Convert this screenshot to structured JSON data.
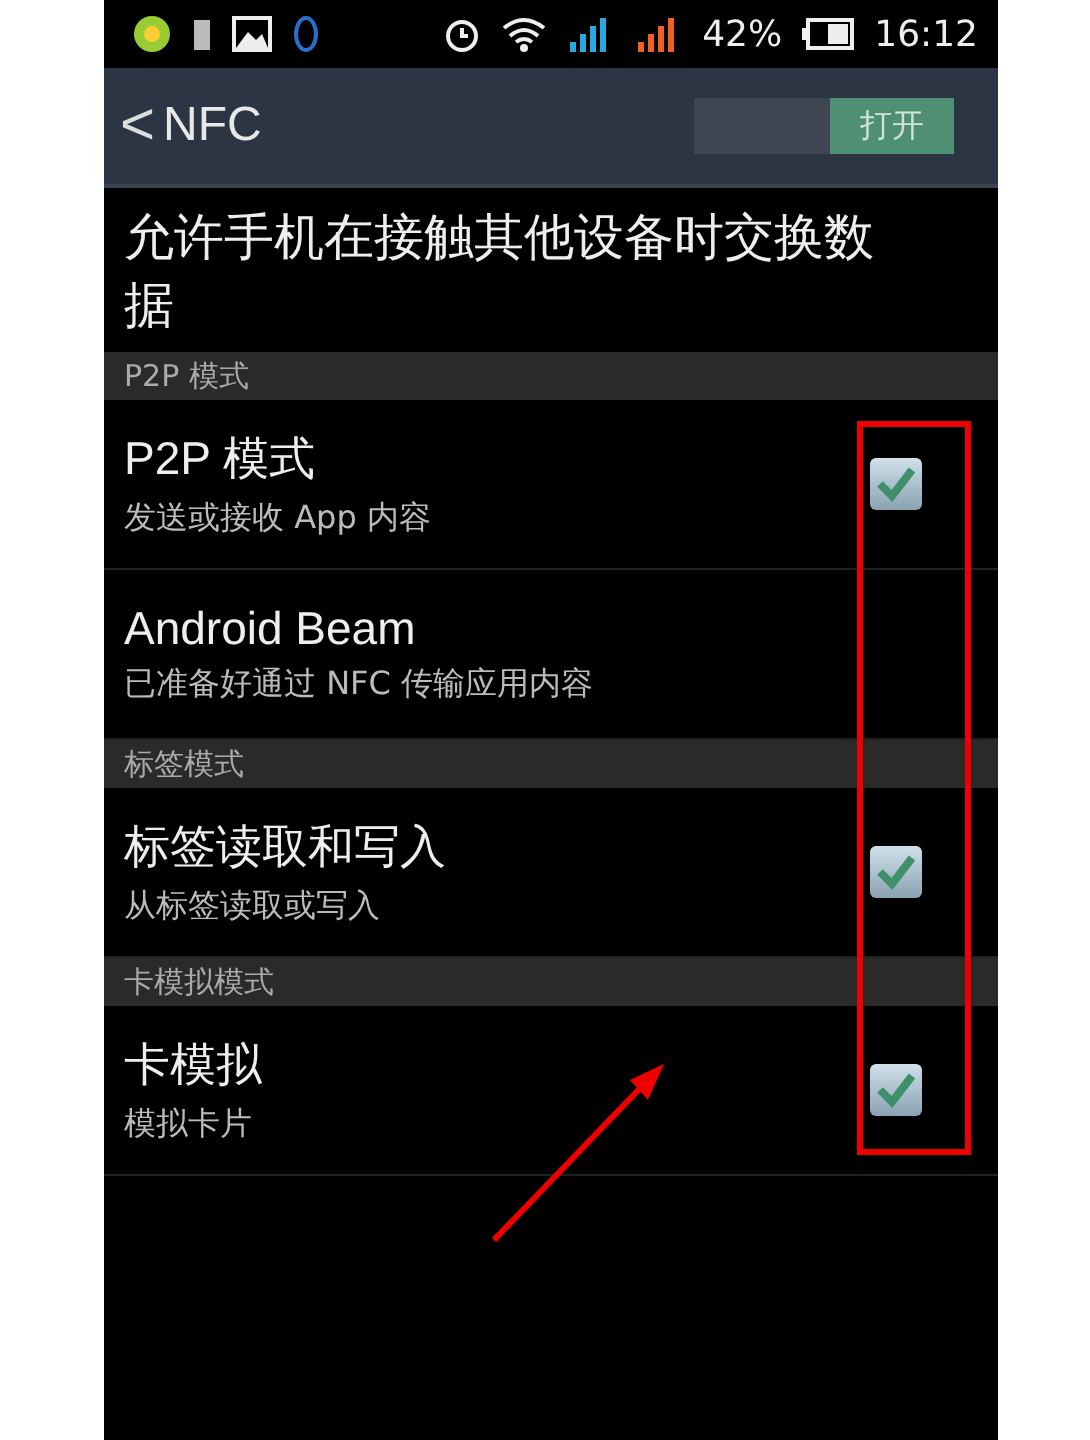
{
  "status_bar": {
    "battery_percent": "42%",
    "time": "16:12"
  },
  "action_bar": {
    "back": "<",
    "title": "NFC",
    "switch": {
      "label": "打开",
      "on": true
    }
  },
  "description": "允许手机在接触其他设备时交换数据",
  "sections": [
    {
      "header": "P2P 模式",
      "items": [
        {
          "title": "P2P 模式",
          "summary": "发送或接收 App 内容",
          "checked": true
        },
        {
          "title": "Android Beam",
          "summary": "已准备好通过 NFC 传输应用内容",
          "checked": false
        }
      ]
    },
    {
      "header": "标签模式",
      "items": [
        {
          "title": "标签读取和写入",
          "summary": "从标签读取或写入",
          "checked": true
        }
      ]
    },
    {
      "header": "卡模拟模式",
      "items": [
        {
          "title": "卡模拟",
          "summary": "模拟卡片",
          "checked": true
        }
      ]
    }
  ]
}
